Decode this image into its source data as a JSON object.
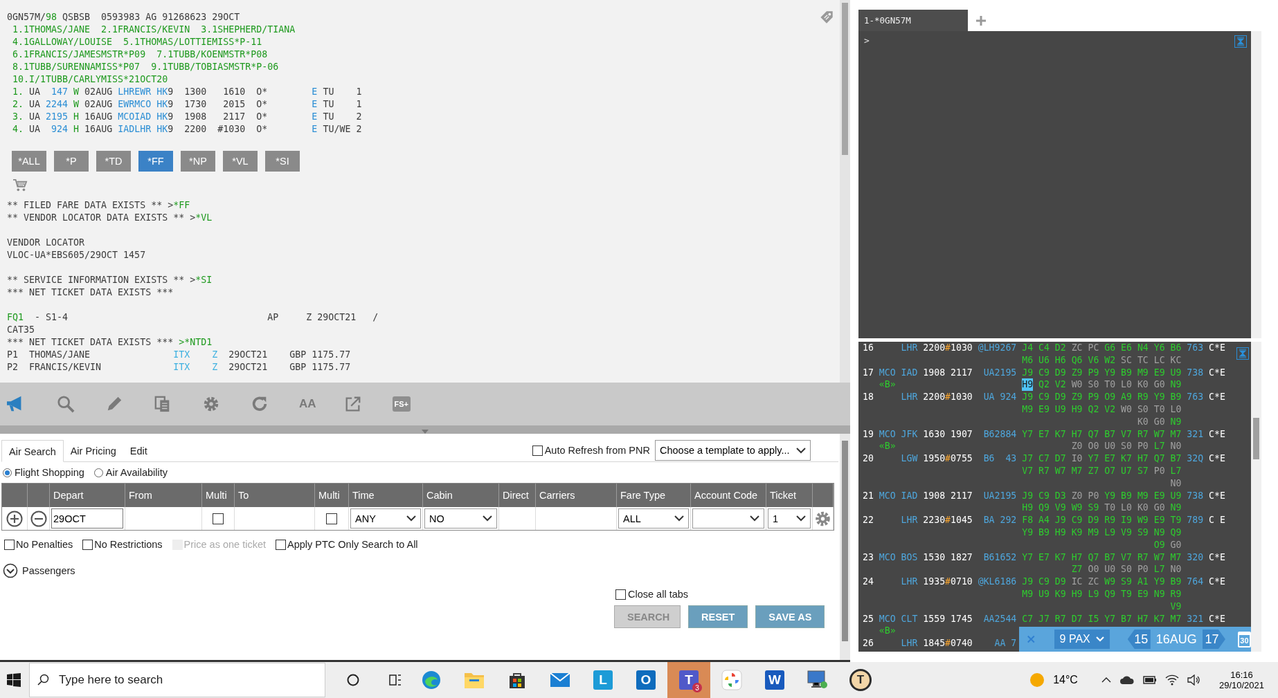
{
  "pnr": {
    "header_lines": [
      [
        {
          "text": "0GN57M/",
          "color": "#3c3c3c"
        },
        {
          "text": "98",
          "color": "#1f9a1f"
        },
        {
          "text": " QSBSB  0593983 AG 91268623 29OCT",
          "color": "#3c3c3c"
        }
      ],
      [
        {
          "text": " 1.1THOMAS/JANE  2.1FRANCIS/KEVIN  3.1SHEPHERD/TIANA",
          "color": "#1f9a1f"
        }
      ],
      [
        {
          "text": " 4.1GALLOWAY/LOUISE  5.1THOMAS/LOTTIEMISS*P-11",
          "color": "#1f9a1f"
        }
      ],
      [
        {
          "text": " 6.1FRANCIS/JAMESMSTR*P09  7.1TUBB/KOENMSTR*P08",
          "color": "#1f9a1f"
        }
      ],
      [
        {
          "text": " 8.1TUBB/SURENNAMISS*P07  9.1TUBB/TOBIASMSTR*P-06",
          "color": "#1f9a1f"
        }
      ],
      [
        {
          "text": " 10.I/1TUBB/CARLYMISS*21OCT20",
          "color": "#1f9a1f"
        }
      ],
      [
        {
          "text": " 1.",
          "color": "#1f9a1f"
        },
        {
          "text": " UA  ",
          "color": "#3c3c3c"
        },
        {
          "text": "147",
          "color": "#2d8fd5"
        },
        {
          "text": " W",
          "color": "#1f9a1f"
        },
        {
          "text": " 02AUG ",
          "color": "#3c3c3c"
        },
        {
          "text": "LHREWR HK",
          "color": "#2d8fd5"
        },
        {
          "text": "9  1300   1610  O*        ",
          "color": "#3c3c3c"
        },
        {
          "text": "E",
          "color": "#2d8fd5"
        },
        {
          "text": " TU    1",
          "color": "#3c3c3c"
        }
      ],
      [
        {
          "text": " 2.",
          "color": "#1f9a1f"
        },
        {
          "text": " UA ",
          "color": "#3c3c3c"
        },
        {
          "text": "2244",
          "color": "#2d8fd5"
        },
        {
          "text": " W",
          "color": "#1f9a1f"
        },
        {
          "text": " 02AUG ",
          "color": "#3c3c3c"
        },
        {
          "text": "EWRMCO HK",
          "color": "#2d8fd5"
        },
        {
          "text": "9  1730   2015  O*        ",
          "color": "#3c3c3c"
        },
        {
          "text": "E",
          "color": "#2d8fd5"
        },
        {
          "text": " TU    1",
          "color": "#3c3c3c"
        }
      ],
      [
        {
          "text": " 3.",
          "color": "#1f9a1f"
        },
        {
          "text": " UA ",
          "color": "#3c3c3c"
        },
        {
          "text": "2195",
          "color": "#2d8fd5"
        },
        {
          "text": " H",
          "color": "#1f9a1f"
        },
        {
          "text": " 16AUG ",
          "color": "#3c3c3c"
        },
        {
          "text": "MCOIAD HK",
          "color": "#2d8fd5"
        },
        {
          "text": "9  1908   2117  O*        ",
          "color": "#3c3c3c"
        },
        {
          "text": "E",
          "color": "#2d8fd5"
        },
        {
          "text": " TU    2",
          "color": "#3c3c3c"
        }
      ],
      [
        {
          "text": " 4.",
          "color": "#1f9a1f"
        },
        {
          "text": " UA  ",
          "color": "#3c3c3c"
        },
        {
          "text": "924",
          "color": "#2d8fd5"
        },
        {
          "text": " H",
          "color": "#1f9a1f"
        },
        {
          "text": " 16AUG ",
          "color": "#3c3c3c"
        },
        {
          "text": "IADLHR HK",
          "color": "#2d8fd5"
        },
        {
          "text": "9  2200  #1030  O*        ",
          "color": "#3c3c3c"
        },
        {
          "text": "E",
          "color": "#2d8fd5"
        },
        {
          "text": " TU/WE 2",
          "color": "#3c3c3c"
        }
      ]
    ],
    "commands": [
      {
        "label": "*ALL",
        "selected": false
      },
      {
        "label": "*P",
        "selected": false
      },
      {
        "label": "*TD",
        "selected": false
      },
      {
        "label": "*FF",
        "selected": true
      },
      {
        "label": "*NP",
        "selected": false
      },
      {
        "label": "*VL",
        "selected": false
      },
      {
        "label": "*SI",
        "selected": false
      }
    ],
    "blocks": [
      [
        [
          {
            "text": "** FILED FARE DATA EXISTS ** >",
            "color": "#3c3c3c"
          },
          {
            "text": "*FF",
            "color": "#1f9a1f"
          }
        ],
        [
          {
            "text": "** VENDOR LOCATOR DATA EXISTS ** >",
            "color": "#3c3c3c"
          },
          {
            "text": "*VL",
            "color": "#1f9a1f"
          }
        ]
      ],
      [
        [
          {
            "text": "VENDOR LOCATOR",
            "color": "#3c3c3c"
          }
        ],
        [
          {
            "text": "VLOC-UA*EBS605/29OCT 1457",
            "color": "#3c3c3c"
          }
        ]
      ],
      [
        [
          {
            "text": "** SERVICE INFORMATION EXISTS ** >",
            "color": "#3c3c3c"
          },
          {
            "text": "*SI",
            "color": "#1f9a1f"
          }
        ],
        [
          {
            "text": "*** NET TICKET DATA EXISTS ***",
            "color": "#3c3c3c"
          }
        ]
      ],
      [
        [
          {
            "text": "FQ1",
            "color": "#1f9a1f"
          },
          {
            "text": "  - S1-4                                    AP     Z 29OCT21   /",
            "color": "#3c3c3c"
          }
        ],
        [
          {
            "text": "CAT35",
            "color": "#3c3c3c"
          }
        ],
        [
          {
            "text": "*** NET TICKET DATA EXISTS *** ",
            "color": "#3c3c3c"
          },
          {
            "text": ">*NTD1",
            "color": "#1f9a1f"
          }
        ],
        [
          {
            "text": "P1  THOMAS/JANE               ",
            "color": "#3c3c3c"
          },
          {
            "text": "ITX    Z",
            "color": "#3db0e0"
          },
          {
            "text": "  29OCT21    GBP 1175.77",
            "color": "#3c3c3c"
          }
        ],
        [
          {
            "text": "P2  FRANCIS/KEVIN             ",
            "color": "#3c3c3c"
          },
          {
            "text": "ITX    Z",
            "color": "#3db0e0"
          },
          {
            "text": "  29OCT21    GBP 1175.77",
            "color": "#3c3c3c"
          }
        ]
      ]
    ]
  },
  "toolbar": {
    "font_label": "AA",
    "fs_label": "FS+"
  },
  "search_form": {
    "tabs": [
      {
        "label": "Air Search",
        "selected": true
      },
      {
        "label": "Air Pricing",
        "selected": false
      },
      {
        "label": "Edit",
        "selected": false
      }
    ],
    "auto_refresh": {
      "label": "Auto Refresh from PNR",
      "checked": false
    },
    "template": {
      "value": "Choose a template to apply..."
    },
    "modes": [
      {
        "label": "Flight Shopping",
        "selected": true
      },
      {
        "label": "Air Availability",
        "selected": false
      }
    ],
    "columns": [
      {
        "label": "Depart",
        "kind": "input",
        "value": "29OCT"
      },
      {
        "label": "From",
        "kind": "input"
      },
      {
        "label": "Multi",
        "kind": "checkbox",
        "checked": false
      },
      {
        "label": "To",
        "kind": "input"
      },
      {
        "label": "Multi",
        "kind": "checkbox",
        "checked": false
      },
      {
        "label": "Time",
        "kind": "select",
        "value": "ANY"
      },
      {
        "label": "Cabin",
        "kind": "select",
        "value": "NO"
      },
      {
        "label": "Direct",
        "kind": "blank"
      },
      {
        "label": "Carriers",
        "kind": "blank"
      },
      {
        "label": "Fare Type",
        "kind": "select",
        "value": "ALL"
      },
      {
        "label": "Account Code",
        "kind": "select"
      },
      {
        "label": "Ticket",
        "kind": "select",
        "value": "1"
      }
    ],
    "options": [
      {
        "label": "No Penalties",
        "checked": false,
        "disabled": false
      },
      {
        "label": "No Restrictions",
        "checked": false,
        "disabled": false
      },
      {
        "label": "Price as one ticket",
        "checked": false,
        "disabled": true
      },
      {
        "label": "Apply PTC Only Search to All",
        "checked": false,
        "disabled": false
      }
    ],
    "passengers": {
      "label": "Passengers",
      "expanded": false
    },
    "close_all_tabs": {
      "label": "Close all tabs",
      "checked": false
    },
    "buttons": [
      {
        "label": "SEARCH",
        "disabled": true
      },
      {
        "label": "RESET",
        "disabled": false
      },
      {
        "label": "SAVE AS",
        "disabled": false
      }
    ]
  },
  "terminal": {
    "tab": {
      "label": "1-*0GN57M",
      "selected": true
    },
    "prompt": ">"
  },
  "availability": {
    "rows": [
      {
        "number": "16",
        "dest": "LHR",
        "dep": "2200",
        "day_change": "#",
        "arr": "1030",
        "flight": "@LH9267",
        "equipment": "763",
        "status": "C*E",
        "classes": [
          {
            "text": "J4",
            "color": "#2ecc2e"
          },
          {
            "text": "C4",
            "color": "#2ecc2e"
          },
          {
            "text": "D2",
            "color": "#2ecc2e"
          },
          {
            "text": "ZC",
            "color": "#a0a0a0"
          },
          {
            "text": "PC",
            "color": "#a0a0a0"
          },
          {
            "text": "G6",
            "color": "#2ecc2e"
          },
          {
            "text": "E6",
            "color": "#2ecc2e"
          },
          {
            "text": "N4",
            "color": "#2ecc2e"
          },
          {
            "text": "Y6",
            "color": "#2ecc2e"
          },
          {
            "text": "B6",
            "color": "#2ecc2e"
          },
          {
            "text": "M6",
            "color": "#2ecc2e"
          },
          {
            "text": "U6",
            "color": "#2ecc2e"
          },
          {
            "text": "H6",
            "color": "#2ecc2e"
          },
          {
            "text": "Q6",
            "color": "#2ecc2e"
          },
          {
            "text": "V6",
            "color": "#2ecc2e"
          },
          {
            "text": "W2",
            "color": "#2ecc2e"
          },
          {
            "text": "SC",
            "color": "#a0a0a0"
          },
          {
            "text": "TC",
            "color": "#a0a0a0"
          },
          {
            "text": "LC",
            "color": "#a0a0a0"
          },
          {
            "text": "KC",
            "color": "#a0a0a0"
          }
        ]
      },
      {
        "number": "17",
        "origin": "MCO",
        "dest": "IAD",
        "dep": "1908",
        "arr": "2117",
        "flight": "UA2195",
        "note": "«B»",
        "equipment": "738",
        "status": "C*E",
        "classes": [
          {
            "text": "J9",
            "color": "#2ecc2e"
          },
          {
            "text": "C9",
            "color": "#2ecc2e"
          },
          {
            "text": "D9",
            "color": "#2ecc2e"
          },
          {
            "text": "Z9",
            "color": "#2ecc2e"
          },
          {
            "text": "P9",
            "color": "#2ecc2e"
          },
          {
            "text": "Y9",
            "color": "#2ecc2e"
          },
          {
            "text": "B9",
            "color": "#2ecc2e"
          },
          {
            "text": "M9",
            "color": "#2ecc2e"
          },
          {
            "text": "E9",
            "color": "#2ecc2e"
          },
          {
            "text": "U9",
            "color": "#2ecc2e"
          },
          {
            "text": "H9",
            "color": "#4fc3f7",
            "selected": true
          },
          {
            "text": "Q2",
            "color": "#2ecc2e"
          },
          {
            "text": "V2",
            "color": "#2ecc2e"
          },
          {
            "text": "W0",
            "color": "#a0a0a0"
          },
          {
            "text": "S0",
            "color": "#a0a0a0"
          },
          {
            "text": "T0",
            "color": "#a0a0a0"
          },
          {
            "text": "L0",
            "color": "#a0a0a0"
          },
          {
            "text": "K0",
            "color": "#a0a0a0"
          },
          {
            "text": "G0",
            "color": "#a0a0a0"
          },
          {
            "text": "N9",
            "color": "#2ecc2e"
          }
        ]
      },
      {
        "number": "18",
        "dest": "LHR",
        "dep": "2200",
        "day_change": "#",
        "arr": "1030",
        "flight": "UA 924",
        "equipment": "763",
        "status": "C*E",
        "classes": [
          {
            "text": "J9",
            "color": "#2ecc2e"
          },
          {
            "text": "C9",
            "color": "#2ecc2e"
          },
          {
            "text": "D9",
            "color": "#2ecc2e"
          },
          {
            "text": "Z9",
            "color": "#2ecc2e"
          },
          {
            "text": "P9",
            "color": "#2ecc2e"
          },
          {
            "text": "O9",
            "color": "#2ecc2e"
          },
          {
            "text": "A9",
            "color": "#2ecc2e"
          },
          {
            "text": "R9",
            "color": "#2ecc2e"
          },
          {
            "text": "Y9",
            "color": "#2ecc2e"
          },
          {
            "text": "B9",
            "color": "#2ecc2e"
          },
          {
            "text": "M9",
            "color": "#2ecc2e"
          },
          {
            "text": "E9",
            "color": "#2ecc2e"
          },
          {
            "text": "U9",
            "color": "#2ecc2e"
          },
          {
            "text": "H9",
            "color": "#2ecc2e"
          },
          {
            "text": "Q2",
            "color": "#2ecc2e"
          },
          {
            "text": "V2",
            "color": "#2ecc2e"
          },
          {
            "text": "W0",
            "color": "#a0a0a0"
          },
          {
            "text": "S0",
            "color": "#a0a0a0"
          },
          {
            "text": "T0",
            "color": "#a0a0a0"
          },
          {
            "text": "L0",
            "color": "#a0a0a0"
          },
          {
            "text": "K0",
            "color": "#a0a0a0"
          },
          {
            "text": "G0",
            "color": "#a0a0a0"
          },
          {
            "text": "N9",
            "color": "#2ecc2e"
          }
        ]
      },
      {
        "number": "19",
        "origin": "MCO",
        "dest": "JFK",
        "dep": "1630",
        "arr": "1907",
        "flight": "B62884",
        "note": "«B»",
        "equipment": "321",
        "status": "C*E",
        "classes": [
          {
            "text": "Y7",
            "color": "#2ecc2e"
          },
          {
            "text": "E7",
            "color": "#2ecc2e"
          },
          {
            "text": "K7",
            "color": "#2ecc2e"
          },
          {
            "text": "H7",
            "color": "#2ecc2e"
          },
          {
            "text": "Q7",
            "color": "#2ecc2e"
          },
          {
            "text": "B7",
            "color": "#2ecc2e"
          },
          {
            "text": "V7",
            "color": "#2ecc2e"
          },
          {
            "text": "R7",
            "color": "#2ecc2e"
          },
          {
            "text": "W7",
            "color": "#2ecc2e"
          },
          {
            "text": "M7",
            "color": "#2ecc2e"
          },
          {
            "text": "Z0",
            "color": "#a0a0a0"
          },
          {
            "text": "O0",
            "color": "#a0a0a0"
          },
          {
            "text": "U0",
            "color": "#a0a0a0"
          },
          {
            "text": "S0",
            "color": "#a0a0a0"
          },
          {
            "text": "P0",
            "color": "#a0a0a0"
          },
          {
            "text": "L7",
            "color": "#2ecc2e"
          },
          {
            "text": "N0",
            "color": "#a0a0a0"
          }
        ]
      },
      {
        "number": "20",
        "dest": "LGW",
        "dep": "1950",
        "day_change": "#",
        "arr": "0755",
        "flight": "B6  43",
        "equipment": "32Q",
        "status": "C*E",
        "classes": [
          {
            "text": "J7",
            "color": "#2ecc2e"
          },
          {
            "text": "C7",
            "color": "#2ecc2e"
          },
          {
            "text": "D7",
            "color": "#2ecc2e"
          },
          {
            "text": "I0",
            "color": "#a0a0a0"
          },
          {
            "text": "Y7",
            "color": "#2ecc2e"
          },
          {
            "text": "E7",
            "color": "#2ecc2e"
          },
          {
            "text": "K7",
            "color": "#2ecc2e"
          },
          {
            "text": "H7",
            "color": "#2ecc2e"
          },
          {
            "text": "Q7",
            "color": "#2ecc2e"
          },
          {
            "text": "B7",
            "color": "#2ecc2e"
          },
          {
            "text": "V7",
            "color": "#2ecc2e"
          },
          {
            "text": "R7",
            "color": "#2ecc2e"
          },
          {
            "text": "W7",
            "color": "#2ecc2e"
          },
          {
            "text": "M7",
            "color": "#2ecc2e"
          },
          {
            "text": "Z7",
            "color": "#2ecc2e"
          },
          {
            "text": "O7",
            "color": "#2ecc2e"
          },
          {
            "text": "U7",
            "color": "#2ecc2e"
          },
          {
            "text": "S7",
            "color": "#2ecc2e"
          },
          {
            "text": "P0",
            "color": "#a0a0a0"
          },
          {
            "text": "L7",
            "color": "#2ecc2e"
          },
          {
            "text": "N0",
            "color": "#a0a0a0"
          }
        ]
      },
      {
        "number": "21",
        "origin": "MCO",
        "dest": "IAD",
        "dep": "1908",
        "arr": "2117",
        "flight": "UA2195",
        "equipment": "738",
        "status": "C*E",
        "classes": [
          {
            "text": "J9",
            "color": "#2ecc2e"
          },
          {
            "text": "C9",
            "color": "#2ecc2e"
          },
          {
            "text": "D3",
            "color": "#2ecc2e"
          },
          {
            "text": "Z0",
            "color": "#a0a0a0"
          },
          {
            "text": "P0",
            "color": "#a0a0a0"
          },
          {
            "text": "Y9",
            "color": "#2ecc2e"
          },
          {
            "text": "B9",
            "color": "#2ecc2e"
          },
          {
            "text": "M9",
            "color": "#2ecc2e"
          },
          {
            "text": "E9",
            "color": "#2ecc2e"
          },
          {
            "text": "U9",
            "color": "#2ecc2e"
          },
          {
            "text": "H9",
            "color": "#2ecc2e"
          },
          {
            "text": "Q9",
            "color": "#2ecc2e"
          },
          {
            "text": "V9",
            "color": "#2ecc2e"
          },
          {
            "text": "W9",
            "color": "#2ecc2e"
          },
          {
            "text": "S9",
            "color": "#2ecc2e"
          },
          {
            "text": "T0",
            "color": "#a0a0a0"
          },
          {
            "text": "L0",
            "color": "#a0a0a0"
          },
          {
            "text": "K0",
            "color": "#a0a0a0"
          },
          {
            "text": "G0",
            "color": "#a0a0a0"
          },
          {
            "text": "N9",
            "color": "#2ecc2e"
          }
        ]
      },
      {
        "number": "22",
        "dest": "LHR",
        "dep": "2230",
        "day_change": "#",
        "arr": "1045",
        "flight": "BA 292",
        "equipment": "789",
        "status": "C E",
        "classes": [
          {
            "text": "F8",
            "color": "#2ecc2e"
          },
          {
            "text": "A4",
            "color": "#2ecc2e"
          },
          {
            "text": "J9",
            "color": "#2ecc2e"
          },
          {
            "text": "C9",
            "color": "#2ecc2e"
          },
          {
            "text": "D9",
            "color": "#2ecc2e"
          },
          {
            "text": "R9",
            "color": "#2ecc2e"
          },
          {
            "text": "I9",
            "color": "#2ecc2e"
          },
          {
            "text": "W9",
            "color": "#2ecc2e"
          },
          {
            "text": "E9",
            "color": "#2ecc2e"
          },
          {
            "text": "T9",
            "color": "#2ecc2e"
          },
          {
            "text": "Y9",
            "color": "#2ecc2e"
          },
          {
            "text": "B9",
            "color": "#2ecc2e"
          },
          {
            "text": "H9",
            "color": "#2ecc2e"
          },
          {
            "text": "K9",
            "color": "#2ecc2e"
          },
          {
            "text": "M9",
            "color": "#2ecc2e"
          },
          {
            "text": "L9",
            "color": "#2ecc2e"
          },
          {
            "text": "V9",
            "color": "#2ecc2e"
          },
          {
            "text": "S9",
            "color": "#2ecc2e"
          },
          {
            "text": "N9",
            "color": "#2ecc2e"
          },
          {
            "text": "Q9",
            "color": "#2ecc2e"
          },
          {
            "text": "O9",
            "color": "#2ecc2e"
          },
          {
            "text": "G0",
            "color": "#a0a0a0"
          }
        ]
      },
      {
        "number": "23",
        "origin": "MCO",
        "dest": "BOS",
        "dep": "1530",
        "arr": "1827",
        "flight": "B61652",
        "equipment": "320",
        "status": "C*E",
        "classes": [
          {
            "text": "Y7",
            "color": "#2ecc2e"
          },
          {
            "text": "E7",
            "color": "#2ecc2e"
          },
          {
            "text": "K7",
            "color": "#2ecc2e"
          },
          {
            "text": "H7",
            "color": "#2ecc2e"
          },
          {
            "text": "Q7",
            "color": "#2ecc2e"
          },
          {
            "text": "B7",
            "color": "#2ecc2e"
          },
          {
            "text": "V7",
            "color": "#2ecc2e"
          },
          {
            "text": "R7",
            "color": "#2ecc2e"
          },
          {
            "text": "W7",
            "color": "#2ecc2e"
          },
          {
            "text": "M7",
            "color": "#2ecc2e"
          },
          {
            "text": "Z7",
            "color": "#2ecc2e"
          },
          {
            "text": "O0",
            "color": "#a0a0a0"
          },
          {
            "text": "U0",
            "color": "#a0a0a0"
          },
          {
            "text": "S0",
            "color": "#a0a0a0"
          },
          {
            "text": "P0",
            "color": "#a0a0a0"
          },
          {
            "text": "L7",
            "color": "#2ecc2e"
          },
          {
            "text": "N0",
            "color": "#a0a0a0"
          }
        ]
      },
      {
        "number": "24",
        "dest": "LHR",
        "dep": "1935",
        "day_change": "#",
        "arr": "0710",
        "flight": "@KL6186",
        "equipment": "764",
        "status": "C*E",
        "classes": [
          {
            "text": "J9",
            "color": "#2ecc2e"
          },
          {
            "text": "C9",
            "color": "#2ecc2e"
          },
          {
            "text": "D9",
            "color": "#2ecc2e"
          },
          {
            "text": "IC",
            "color": "#a0a0a0"
          },
          {
            "text": "ZC",
            "color": "#a0a0a0"
          },
          {
            "text": "W9",
            "color": "#2ecc2e"
          },
          {
            "text": "S9",
            "color": "#2ecc2e"
          },
          {
            "text": "A1",
            "color": "#2ecc2e"
          },
          {
            "text": "Y9",
            "color": "#2ecc2e"
          },
          {
            "text": "B9",
            "color": "#2ecc2e"
          },
          {
            "text": "M9",
            "color": "#2ecc2e"
          },
          {
            "text": "U9",
            "color": "#2ecc2e"
          },
          {
            "text": "K9",
            "color": "#2ecc2e"
          },
          {
            "text": "H9",
            "color": "#2ecc2e"
          },
          {
            "text": "L9",
            "color": "#2ecc2e"
          },
          {
            "text": "Q9",
            "color": "#2ecc2e"
          },
          {
            "text": "T9",
            "color": "#2ecc2e"
          },
          {
            "text": "E9",
            "color": "#2ecc2e"
          },
          {
            "text": "N9",
            "color": "#2ecc2e"
          },
          {
            "text": "R9",
            "color": "#2ecc2e"
          },
          {
            "text": "V9",
            "color": "#2ecc2e"
          }
        ]
      },
      {
        "number": "25",
        "origin": "MCO",
        "dest": "CLT",
        "dep": "1559",
        "arr": "1745",
        "flight": "AA2544",
        "note": "«B»",
        "equipment": "321",
        "status": "C*E",
        "classes": [
          {
            "text": "C7",
            "color": "#2ecc2e"
          },
          {
            "text": "J7",
            "color": "#2ecc2e"
          },
          {
            "text": "R7",
            "color": "#2ecc2e"
          },
          {
            "text": "D7",
            "color": "#2ecc2e"
          },
          {
            "text": "I5",
            "color": "#2ecc2e"
          },
          {
            "text": "Y7",
            "color": "#2ecc2e"
          },
          {
            "text": "B7",
            "color": "#2ecc2e"
          },
          {
            "text": "H7",
            "color": "#2ecc2e"
          },
          {
            "text": "K7",
            "color": "#2ecc2e"
          },
          {
            "text": "M7",
            "color": "#2ecc2e"
          }
        ]
      },
      {
        "number": "26",
        "dest": "LHR",
        "dep": "1845",
        "day_change": "#",
        "arr": "0740",
        "flight": "AA 7"
      }
    ],
    "bar": {
      "pax": "9 PAX",
      "prev": "15",
      "date": "16AUG",
      "next": "17",
      "calendar": "30"
    }
  },
  "taskbar": {
    "search": {
      "placeholder": "Type here to search"
    },
    "apps": [
      {
        "kind": "browser",
        "active": false
      },
      {
        "kind": "folder",
        "active": false
      },
      {
        "kind": "store",
        "active": false
      },
      {
        "kind": "mail",
        "active": false
      },
      {
        "kind": "tile",
        "label": "L",
        "color": "#1d9bd7",
        "active": false
      },
      {
        "kind": "tile",
        "label": "O",
        "color": "#0f6cbd",
        "active": false
      },
      {
        "kind": "tile",
        "label": "T",
        "color": "#5059c9",
        "badge": "3",
        "active": true
      },
      {
        "kind": "photos",
        "active": false
      },
      {
        "kind": "tile",
        "label": "W",
        "color": "#185abd",
        "active": false
      },
      {
        "kind": "remote",
        "active": false
      },
      {
        "kind": "round",
        "label": "T",
        "color": "#2b2b2b",
        "active": false
      }
    ],
    "weather": "14°C",
    "time": "16:16",
    "date": "29/10/2021"
  }
}
